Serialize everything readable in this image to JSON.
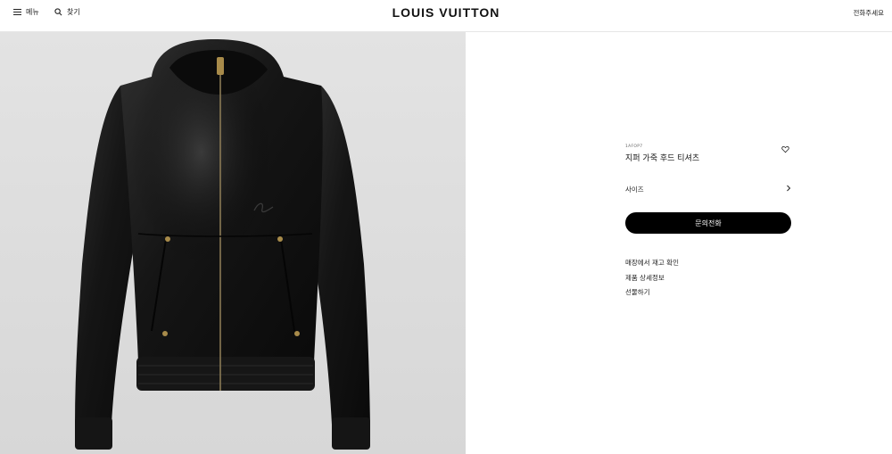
{
  "header": {
    "menu_label": "메뉴",
    "search_label": "찾기",
    "logo": "LOUIS VUITTON",
    "call_label": "전화주세요"
  },
  "product": {
    "sku": "1AFOP7",
    "name": "지퍼 가죽 후드 티셔츠",
    "size_label": "사이즈",
    "cta_label": "문의전화",
    "links": [
      "매장에서 재고 확인",
      "제품 상세정보",
      "선물하기"
    ]
  },
  "colors": {
    "accent": "#000000",
    "background": "#ffffff"
  },
  "icons": [
    "menu-icon",
    "search-icon",
    "heart-icon",
    "chevron-right-icon"
  ]
}
